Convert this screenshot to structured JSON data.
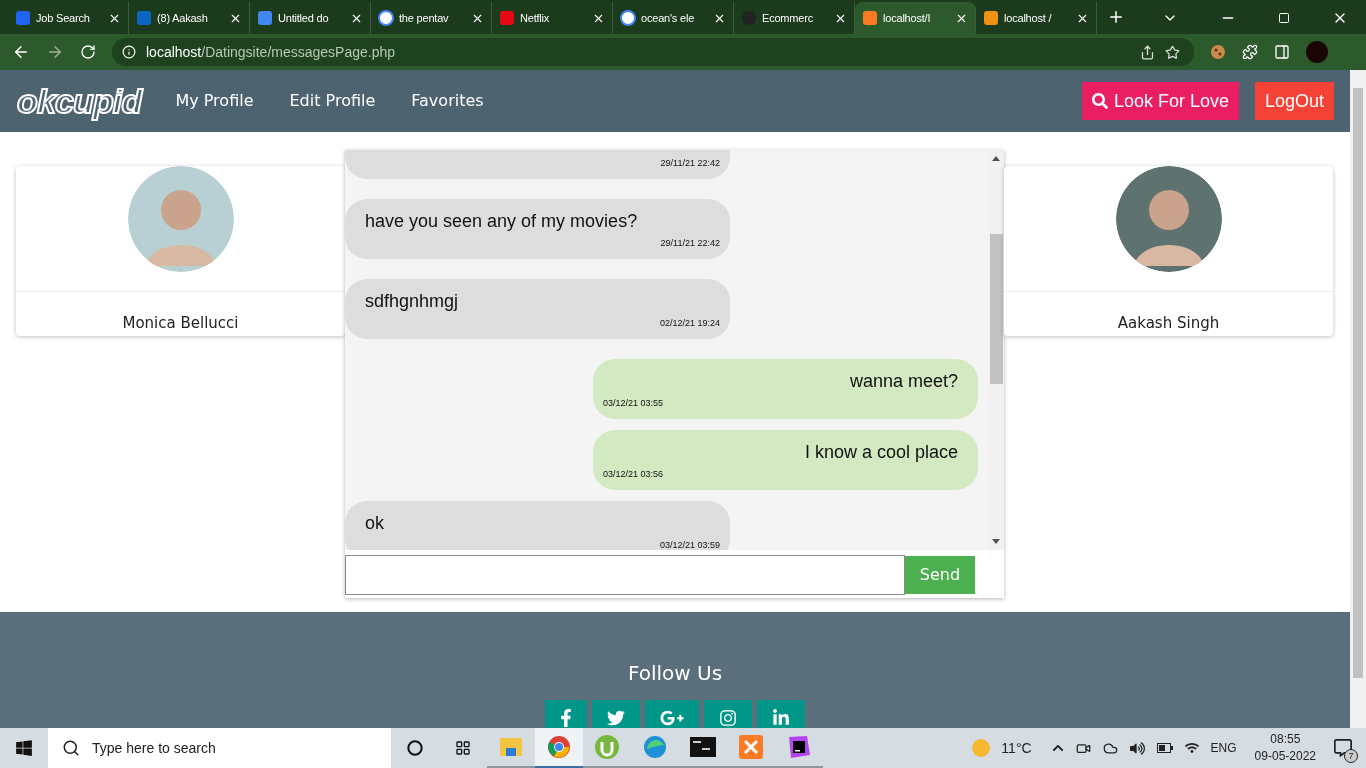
{
  "browser": {
    "tabs": [
      {
        "title": "Job Search",
        "kind": "indeed",
        "selected": false
      },
      {
        "title": "(8) Aakash",
        "kind": "linkedin",
        "selected": false
      },
      {
        "title": "Untitled do",
        "kind": "docs",
        "selected": false
      },
      {
        "title": "the pentav",
        "kind": "google",
        "selected": false
      },
      {
        "title": "Netflix",
        "kind": "netflix",
        "selected": false
      },
      {
        "title": "ocean's ele",
        "kind": "google",
        "selected": false
      },
      {
        "title": "Ecommerc",
        "kind": "github",
        "selected": false
      },
      {
        "title": "localhost/I",
        "kind": "xampp",
        "selected": true
      },
      {
        "title": "localhost /",
        "kind": "pma",
        "selected": false
      }
    ],
    "address": {
      "host": "localhost",
      "path": "/Datingsite/messagesPage.php"
    }
  },
  "nav": {
    "logo": "okcupid",
    "links": [
      "My Profile",
      "Edit Profile",
      "Favorites"
    ],
    "search_button": "Look For Love",
    "logout_button": "LogOut"
  },
  "profiles": [
    {
      "name": "Monica Bellucci"
    },
    {
      "name": "Aakash Singh"
    }
  ],
  "messages": [
    {
      "kind": "received",
      "time": "29/11/21 22:42"
    },
    {
      "kind": "received",
      "text": "have you seen any of my movies?",
      "time": "29/11/21 22:42"
    },
    {
      "kind": "received",
      "text": "sdfhgnhmgj",
      "time": "02/12/21 19:24"
    },
    {
      "kind": "sent",
      "text": "wanna meet?",
      "time": "03/12/21 03:55"
    },
    {
      "kind": "sent",
      "text": "I know a cool place",
      "time": "03/12/21 03:56"
    },
    {
      "kind": "received",
      "text": "ok",
      "time": "03/12/21 03:59"
    }
  ],
  "composer": {
    "send_button": "Send"
  },
  "footer": {
    "heading": "Follow Us",
    "social": [
      {
        "kind": "facebook"
      },
      {
        "kind": "twitter"
      },
      {
        "kind": "googleplus"
      },
      {
        "kind": "instagram"
      },
      {
        "kind": "linkedin"
      }
    ]
  },
  "taskbar": {
    "search_placeholder": "Type here to search",
    "apps": [
      {
        "kind": "explorer",
        "selected": false
      },
      {
        "kind": "chrome",
        "selected": true
      },
      {
        "kind": "utorrent",
        "selected": false
      },
      {
        "kind": "edge",
        "selected": false
      },
      {
        "kind": "terminal",
        "selected": false
      },
      {
        "kind": "xampp",
        "selected": false
      },
      {
        "kind": "phpstorm",
        "selected": false
      }
    ],
    "temperature": "11°C",
    "language": "ENG",
    "time": "08:55",
    "date": "09-05-2022",
    "notifications": "7"
  }
}
